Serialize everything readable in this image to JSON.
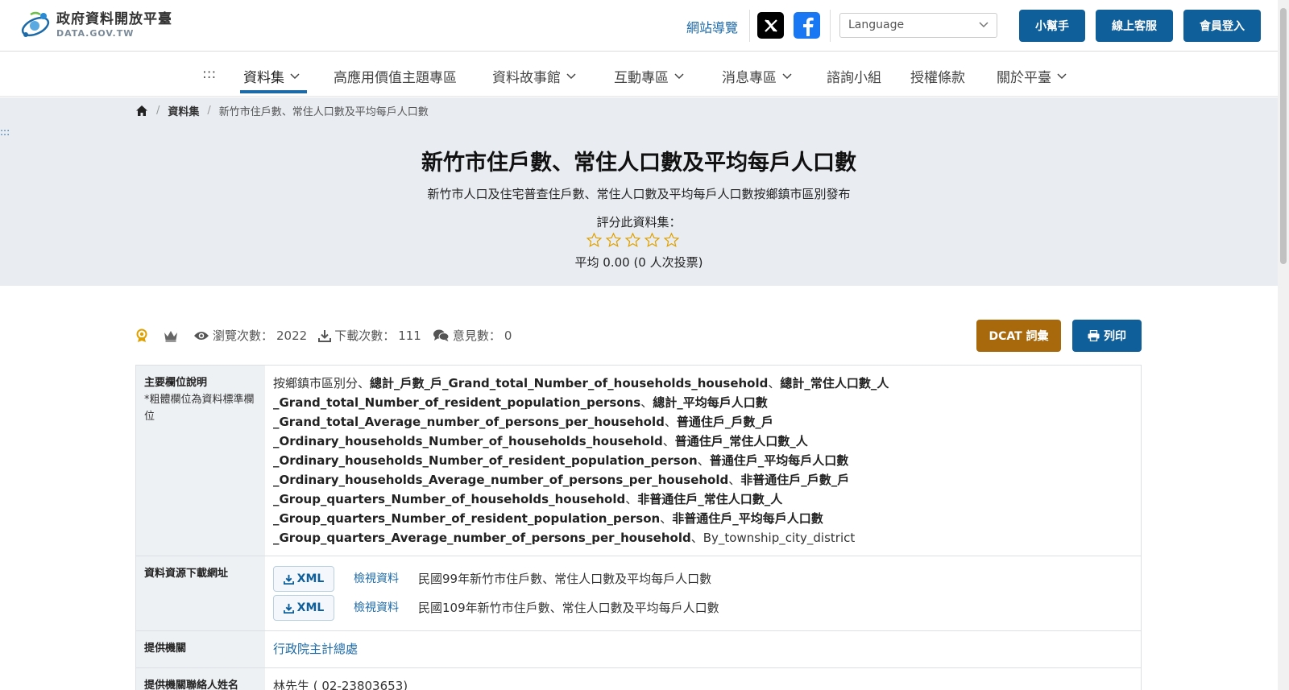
{
  "header": {
    "logo_cn": "政府資料開放平臺",
    "logo_en": "DATA.GOV.TW",
    "site_nav": "網站導覽",
    "language_placeholder": "Language",
    "btn_helper": "小幫手",
    "btn_service": "線上客服",
    "btn_login": "會員登入"
  },
  "nav": {
    "access": ":::",
    "items": [
      "資料集",
      "高應用價值主題專區",
      "資料故事館",
      "互動專區",
      "消息專區",
      "諮詢小組",
      "授權條款",
      "關於平臺"
    ],
    "active": "資料集"
  },
  "breadcrumb": {
    "level1": "資料集",
    "current": "新竹市住戶數、常住人口數及平均每戶人口數"
  },
  "hero": {
    "access": ":::",
    "title": "新竹市住戶數、常住人口數及平均每戶人口數",
    "subtitle": "新竹市人口及住宅普查住戶數、常住人口數及平均每戶人口數按鄉鎮市區別發布",
    "rate_label": "評分此資料集：",
    "stars_filled": 0,
    "stars_total": 5,
    "average": "平均 0.00 (0 人次投票)"
  },
  "stats": {
    "views_label": "瀏覽次數：",
    "views": "2022",
    "downloads_label": "下載次數：",
    "downloads": "111",
    "comments_label": "意見數：",
    "comments": "0",
    "btn_dcat": "DCAT 詞彙",
    "btn_print": "列印"
  },
  "table": {
    "fields_header": "主要欄位說明",
    "fields_note": "*粗體欄位為資料標準欄位",
    "fields_prefix": "按鄉鎮市區別分、",
    "fields_bold": [
      "總計_戶數_戶_Grand_total_Number_of_households_household",
      "總計_常住人口數_人_Grand_total_Number_of_resident_population_persons",
      "總計_平均每戶人口數_Grand_total_Average_number_of_persons_per_household",
      "普通住戶_戶數_戶_Ordinary_households_Number_of_households_household",
      "普通住戶_常住人口數_人_Ordinary_households_Number_of_resident_population_person",
      "普通住戶_平均每戶人口數_Ordinary_households_Average_number_of_persons_per_household",
      "非普通住戶_戶數_戶_Group_quarters_Number_of_households_household",
      "非普通住戶_常住人口數_人_Group_quarters_Number_of_resident_population_person",
      "非普通住戶_平均每戶人口數_Group_quarters_Average_number_of_persons_per_household"
    ],
    "fields_suffix": "By_township_city_district",
    "resources_header": "資料資源下載網址",
    "resources": [
      {
        "format": "XML",
        "view": "檢視資料",
        "name": "民國99年新竹市住戶數、常住人口數及平均每戶人口數"
      },
      {
        "format": "XML",
        "view": "檢視資料",
        "name": "民國109年新竹市住戶數、常住人口數及平均每戶人口數"
      }
    ],
    "agency_header": "提供機關",
    "agency": "行政院主計總處",
    "contact_header": "提供機關聯絡人姓名",
    "contact": "林先生 ( 02-23803653)"
  }
}
